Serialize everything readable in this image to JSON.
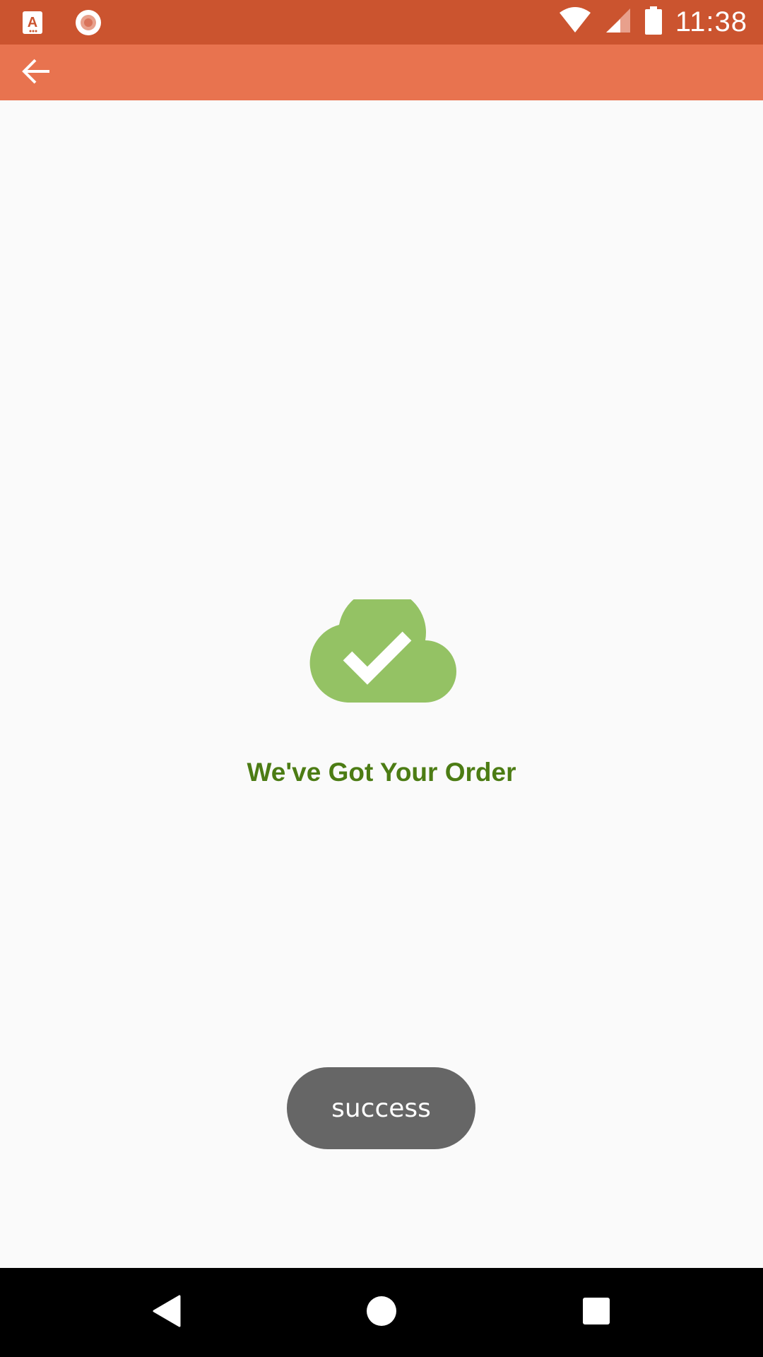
{
  "status_bar": {
    "time": "11:38",
    "icons": [
      "app-a-icon",
      "record-icon",
      "wifi-icon",
      "signal-icon",
      "battery-icon"
    ],
    "background": "#cb542f"
  },
  "app_bar": {
    "background": "#e8734f",
    "back_icon": "arrow-back-icon"
  },
  "main": {
    "success_icon": "cloud-check-icon",
    "icon_color": "#94c264",
    "message": "We've Got Your Order",
    "message_color": "#4c7c14"
  },
  "toast": {
    "text": "success"
  },
  "nav_bar": {
    "items": [
      "back-triangle-icon",
      "home-circle-icon",
      "recents-square-icon"
    ]
  }
}
